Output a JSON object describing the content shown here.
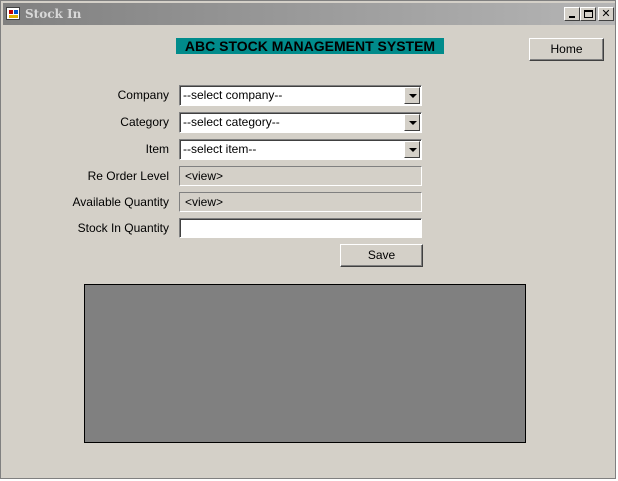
{
  "window": {
    "title": "Stock In",
    "controls": {
      "minimize": "minimize-icon",
      "maximize": "maximize-icon",
      "close": "close-icon",
      "close_glyph": "✕"
    }
  },
  "header": {
    "title": "ABC STOCK MANAGEMENT SYSTEM"
  },
  "nav": {
    "home_label": "Home"
  },
  "form": {
    "company": {
      "label": "Company",
      "selected": "--select company--"
    },
    "category": {
      "label": "Category",
      "selected": "--select category--"
    },
    "item": {
      "label": "Item",
      "selected": "--select item--"
    },
    "reorder_level": {
      "label": "Re Order Level",
      "value": "<view>"
    },
    "available_quantity": {
      "label": "Available Quantity",
      "value": "<view>"
    },
    "stock_in_quantity": {
      "label": "Stock In Quantity",
      "value": ""
    },
    "save_label": "Save"
  },
  "colors": {
    "heading_bg": "#008b8b",
    "window_bg": "#d4d0c8",
    "grid_bg": "#808080"
  }
}
